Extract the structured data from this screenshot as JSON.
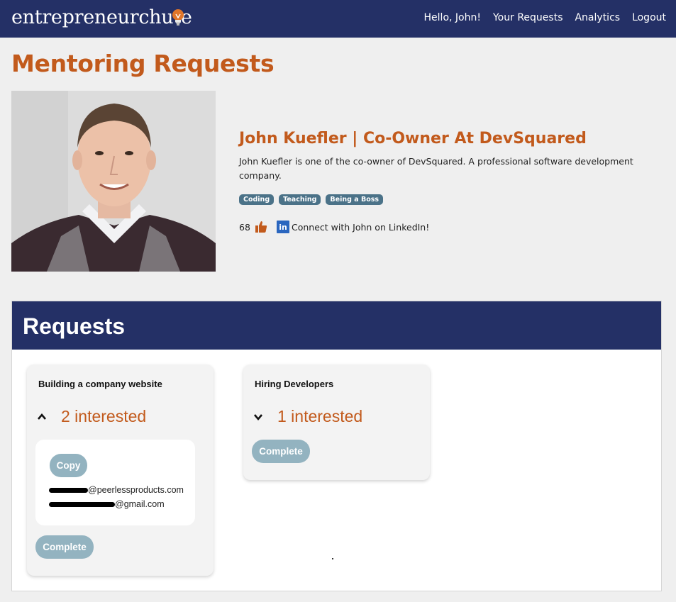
{
  "nav": {
    "brand": "entrepreneurchute",
    "links": [
      "Hello, John!",
      "Your Requests",
      "Analytics",
      "Logout"
    ]
  },
  "page": {
    "title": "Mentoring Requests"
  },
  "profile": {
    "name": "John Kuefler | Co-Owner At DevSquared",
    "description": "John Kuefler is one of the co-owner of DevSquared. A professional software development company.",
    "tags": [
      "Coding",
      "Teaching",
      "Being a Boss"
    ],
    "likes": "68",
    "linkedin_text": "Connect with John on LinkedIn!",
    "linkedin_icon": "in"
  },
  "requests": {
    "title": "Requests",
    "cards": [
      {
        "title": "Building a company website",
        "interested": "2 interested",
        "copy_label": "Copy",
        "emails": [
          "@peerlessproducts.com",
          "@gmail.com"
        ],
        "complete_label": "Complete"
      },
      {
        "title": "Hiring Developers",
        "interested": "1 interested",
        "complete_label": "Complete"
      }
    ]
  },
  "colors": {
    "navy": "#243066",
    "accent_orange": "#c25a1c",
    "tag_blue": "#4b7288",
    "button_gray_blue": "#93b3c0"
  }
}
